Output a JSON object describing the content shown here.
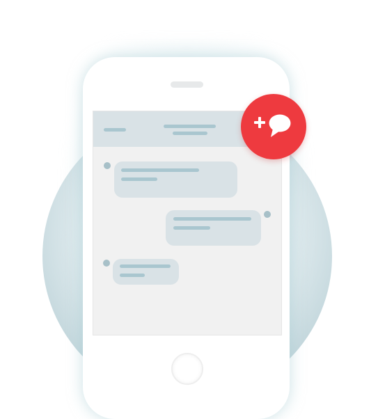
{
  "illustration": {
    "subject": "smartphone-chat",
    "colors": {
      "accent": "#ee3a3f",
      "header": "#d9e2e6",
      "bubble": "#d9e2e6",
      "placeholder_line": "#a9c6cf",
      "screen": "#f1f1f1",
      "backdrop": "#cfe0e4"
    },
    "new_chat_button": {
      "icon": "add-comment-icon"
    },
    "messages": [
      {
        "side": "left",
        "lines": 2
      },
      {
        "side": "right",
        "lines": 2
      },
      {
        "side": "left",
        "lines": 2
      }
    ]
  }
}
